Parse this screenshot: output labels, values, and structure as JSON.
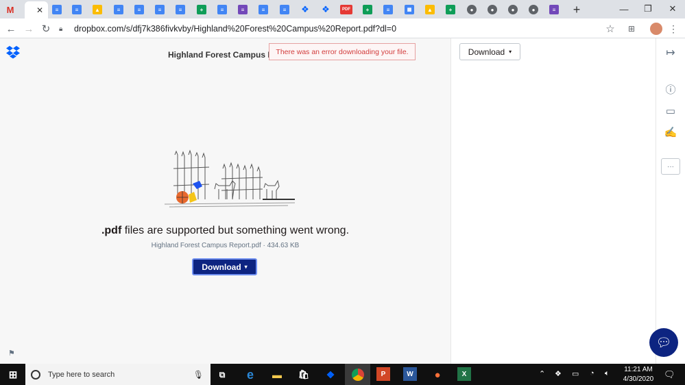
{
  "browser": {
    "url": "dropbox.com/s/dfj7k386fivkvby/Highland%20Forest%20Campus%20Report.pdf?dl=0",
    "new_tab_label": "+"
  },
  "doc": {
    "title": "Highland Forest Campus Re",
    "error": "There was an error downloading your file.",
    "message_ext": ".pdf",
    "message_rest": " files are supported but something went wrong.",
    "file_info": "Highland Forest Campus Report.pdf · 434.63 KB",
    "download_label": "Download",
    "caret": "▾"
  },
  "side": {
    "download_label": "Download",
    "caret": "▾"
  },
  "rail": {
    "more_label": "···"
  },
  "taskbar": {
    "search_placeholder": "Type here to search",
    "time": "11:21 AM",
    "date": "4/30/2020",
    "ppt_label": "P",
    "word_label": "W",
    "excel_label": "X"
  },
  "colors": {
    "dropbox_blue": "#0061fe",
    "button_navy": "#0d2481",
    "error_red": "#d23c3c"
  }
}
